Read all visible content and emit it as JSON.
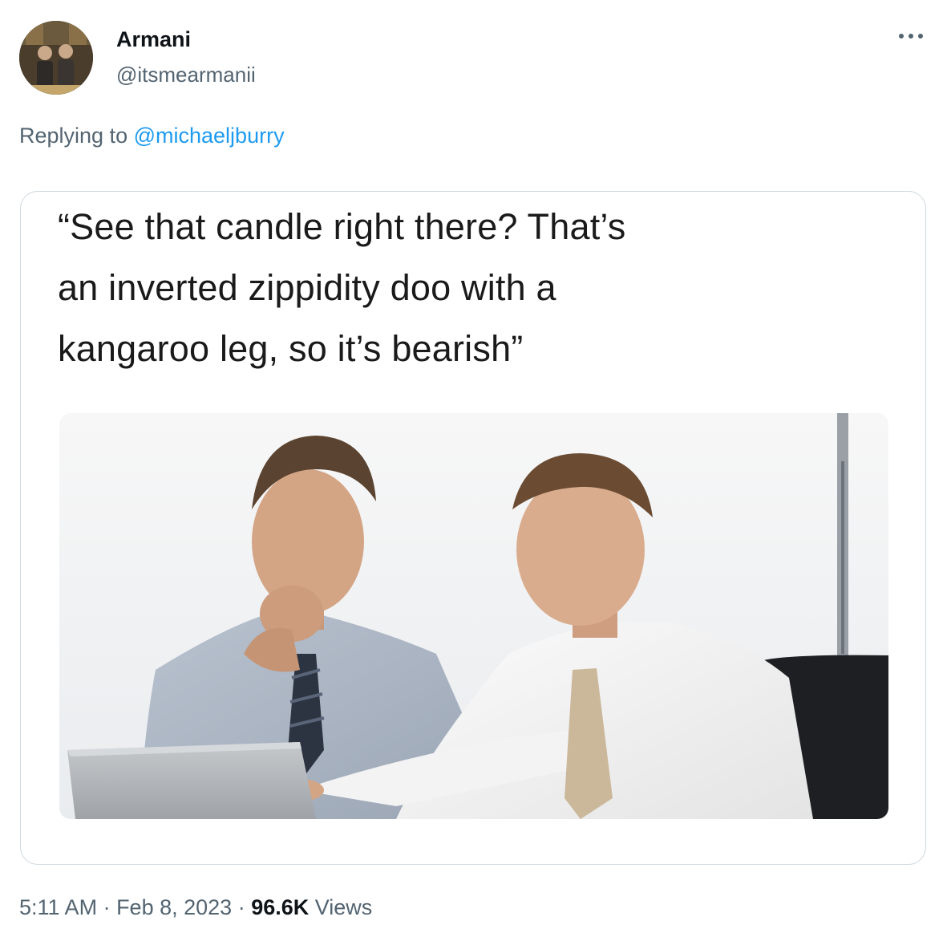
{
  "tweet": {
    "author": {
      "display_name": "Armani",
      "handle": "@itsmearmanii",
      "avatar_icon": "profile-photo"
    },
    "more_icon": "more-options-icon",
    "reply": {
      "prefix": "Replying to",
      "mention": "@michaeljburry"
    },
    "media": {
      "caption_lines": [
        "“See that candle right there? That’s",
        "an inverted zippidity doo with a",
        "kangaroo leg, so it’s bearish”"
      ]
    },
    "meta": {
      "time": "5:11 AM",
      "sep1": " · ",
      "date": "Feb 8, 2023",
      "sep2": " · ",
      "views_count": "96.6K",
      "views_label": "Views"
    }
  },
  "colors": {
    "text_primary": "#0f1419",
    "text_secondary": "#536471",
    "link": "#1d9bf0",
    "border": "#cfd9de"
  }
}
